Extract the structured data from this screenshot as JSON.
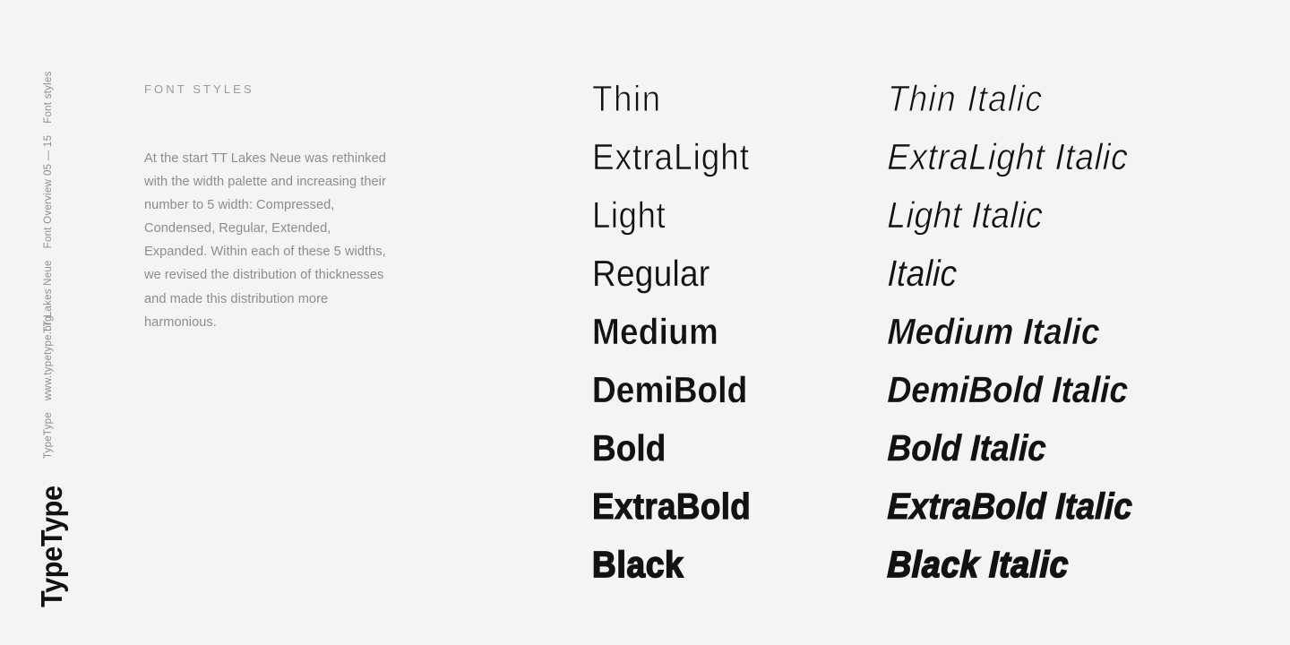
{
  "page": {
    "background_color": "#f4f4f2",
    "text_color": "#121212",
    "muted_text_color": "#8d8d8b",
    "heading_color": "#9b9b99"
  },
  "sidebar": {
    "pagination": {
      "range": "05 — 15",
      "section": "Font styles"
    },
    "document": {
      "family": "TT Lakes Neue",
      "subtitle": "Font Overview"
    },
    "brand": {
      "name": "TypeType",
      "website": "www.typetype.org"
    },
    "logo": "TypeType"
  },
  "info": {
    "heading": "FONT STYLES",
    "body": "At the start TT Lakes Neue was rethinked with the width palette and increasing their number to 5 width: Compressed, Condensed, Regular, Extended, Expanded. Within each of these 5 widths, we revised the distribution of thicknesses and made this distribution more harmonious."
  },
  "specimens": {
    "rows": [
      {
        "roman": "Thin",
        "italic": "Thin Italic",
        "weight_class": "w-thin"
      },
      {
        "roman": "ExtraLight",
        "italic": "ExtraLight Italic",
        "weight_class": "w-extralight"
      },
      {
        "roman": "Light",
        "italic": "Light Italic",
        "weight_class": "w-light"
      },
      {
        "roman": "Regular",
        "italic": "Italic",
        "weight_class": "w-regular"
      },
      {
        "roman": "Medium",
        "italic": "Medium Italic",
        "weight_class": "w-medium"
      },
      {
        "roman": "DemiBold",
        "italic": "DemiBold Italic",
        "weight_class": "w-demibold"
      },
      {
        "roman": "Bold",
        "italic": "Bold Italic",
        "weight_class": "w-bold"
      },
      {
        "roman": "ExtraBold",
        "italic": "ExtraBold Italic",
        "weight_class": "w-extrabold"
      },
      {
        "roman": "Black",
        "italic": "Black Italic",
        "weight_class": "w-black"
      }
    ]
  }
}
